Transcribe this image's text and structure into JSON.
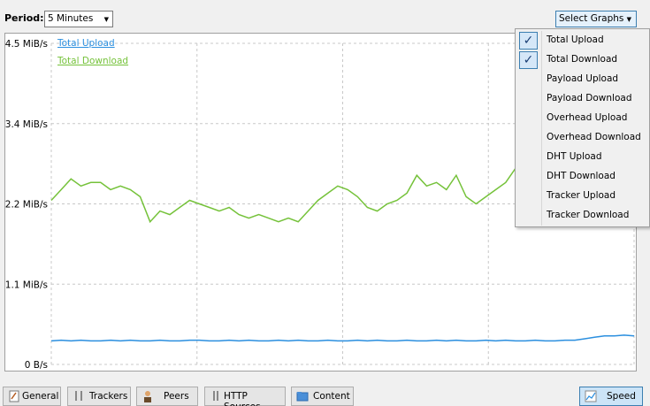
{
  "period": {
    "label": "Period:",
    "value": "5 Minutes"
  },
  "select_graphs": {
    "label": "Select Graphs"
  },
  "chart_data": {
    "type": "line",
    "y_tick_labels": [
      "4.5 MiB/s",
      "3.4 MiB/s",
      "2.2 MiB/s",
      "1.1 MiB/s",
      "0 B/s"
    ],
    "ylim": [
      0,
      4.5
    ],
    "grid": true,
    "series": [
      {
        "name": "Total Upload",
        "color": "#2b8fdf",
        "values": [
          0.33,
          0.34,
          0.33,
          0.34,
          0.33,
          0.33,
          0.34,
          0.33,
          0.34,
          0.33,
          0.33,
          0.34,
          0.33,
          0.33,
          0.34,
          0.34,
          0.33,
          0.33,
          0.34,
          0.33,
          0.34,
          0.33,
          0.33,
          0.34,
          0.33,
          0.34,
          0.33,
          0.33,
          0.34,
          0.33,
          0.33,
          0.34,
          0.33,
          0.34,
          0.33,
          0.33,
          0.34,
          0.33,
          0.33,
          0.34,
          0.33,
          0.34,
          0.33,
          0.33,
          0.34,
          0.33,
          0.34,
          0.33,
          0.33,
          0.34,
          0.33,
          0.33,
          0.34,
          0.34,
          0.36,
          0.38,
          0.4,
          0.4,
          0.41,
          0.4
        ]
      },
      {
        "name": "Total Download",
        "color": "#75c23a",
        "values": [
          2.3,
          2.45,
          2.6,
          2.5,
          2.55,
          2.55,
          2.45,
          2.5,
          2.45,
          2.35,
          2.0,
          2.15,
          2.1,
          2.2,
          2.3,
          2.25,
          2.2,
          2.15,
          2.2,
          2.1,
          2.05,
          2.1,
          2.05,
          2.0,
          2.05,
          2.0,
          2.15,
          2.3,
          2.4,
          2.5,
          2.45,
          2.35,
          2.2,
          2.15,
          2.25,
          2.3,
          2.4,
          2.65,
          2.5,
          2.55,
          2.45,
          2.65,
          2.35,
          2.25,
          2.35,
          2.45,
          2.55,
          2.75,
          2.6,
          2.45,
          2.35,
          2.65,
          2.75,
          2.6,
          2.5,
          2.55,
          2.45,
          2.3,
          2.4,
          2.6
        ]
      }
    ]
  },
  "graph_menu": [
    {
      "label": "Total Upload",
      "checked": true
    },
    {
      "label": "Total Download",
      "checked": true
    },
    {
      "label": "Payload Upload",
      "checked": false
    },
    {
      "label": "Payload Download",
      "checked": false
    },
    {
      "label": "Overhead Upload",
      "checked": false
    },
    {
      "label": "Overhead Download",
      "checked": false
    },
    {
      "label": "DHT Upload",
      "checked": false
    },
    {
      "label": "DHT Download",
      "checked": false
    },
    {
      "label": "Tracker Upload",
      "checked": false
    },
    {
      "label": "Tracker Download",
      "checked": false
    }
  ],
  "tabs": [
    {
      "label": "General",
      "icon": "document-icon"
    },
    {
      "label": "Trackers",
      "icon": "trackers-icon"
    },
    {
      "label": "Peers",
      "icon": "peers-icon"
    },
    {
      "label": "HTTP Sources",
      "icon": "http-sources-icon"
    },
    {
      "label": "Content",
      "icon": "folder-icon"
    },
    {
      "label": "Speed",
      "icon": "speed-graph-icon"
    }
  ]
}
